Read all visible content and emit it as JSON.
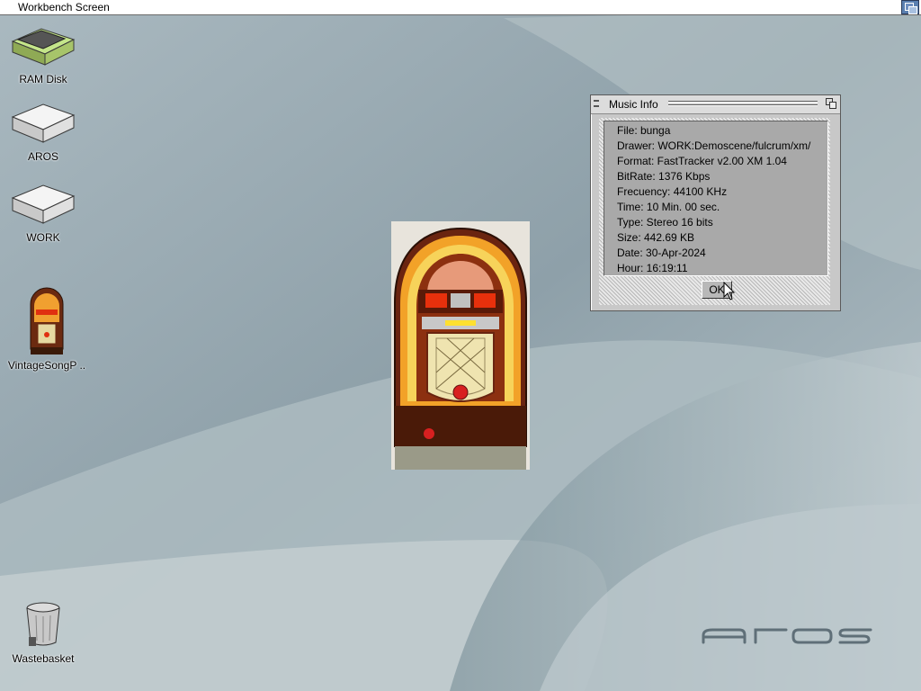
{
  "screen": {
    "title": "Workbench Screen"
  },
  "desktop_icons": [
    {
      "label": "RAM Disk"
    },
    {
      "label": "AROS"
    },
    {
      "label": "WORK"
    },
    {
      "label": "VintageSongP .."
    },
    {
      "label": "Wastebasket"
    }
  ],
  "window": {
    "title": "Music Info",
    "info_lines": [
      "File: bunga",
      "Drawer: WORK:Demoscene/fulcrum/xm/",
      "Format: FastTracker v2.00 XM 1.04",
      "BitRate: 1376 Kbps",
      "Frecuency: 44100 KHz",
      "Time: 10 Min. 00 sec.",
      "Type: Stereo 16 bits",
      "Size: 442.69 KB",
      "Date: 30-Apr-2024",
      "Hour: 16:19:11"
    ],
    "ok_label": "OK"
  },
  "colors": {
    "desktop_base": "#9fb0b8",
    "window_bg": "#c8c8c8",
    "info_panel_bg": "#a9a9a9",
    "screen_depth_button": "#5a7fb0"
  },
  "icons": [
    "drive-icon",
    "window-depth-icon",
    "close-icon",
    "trashcan-icon",
    "jukebox-icon",
    "pointer-cursor-icon"
  ]
}
